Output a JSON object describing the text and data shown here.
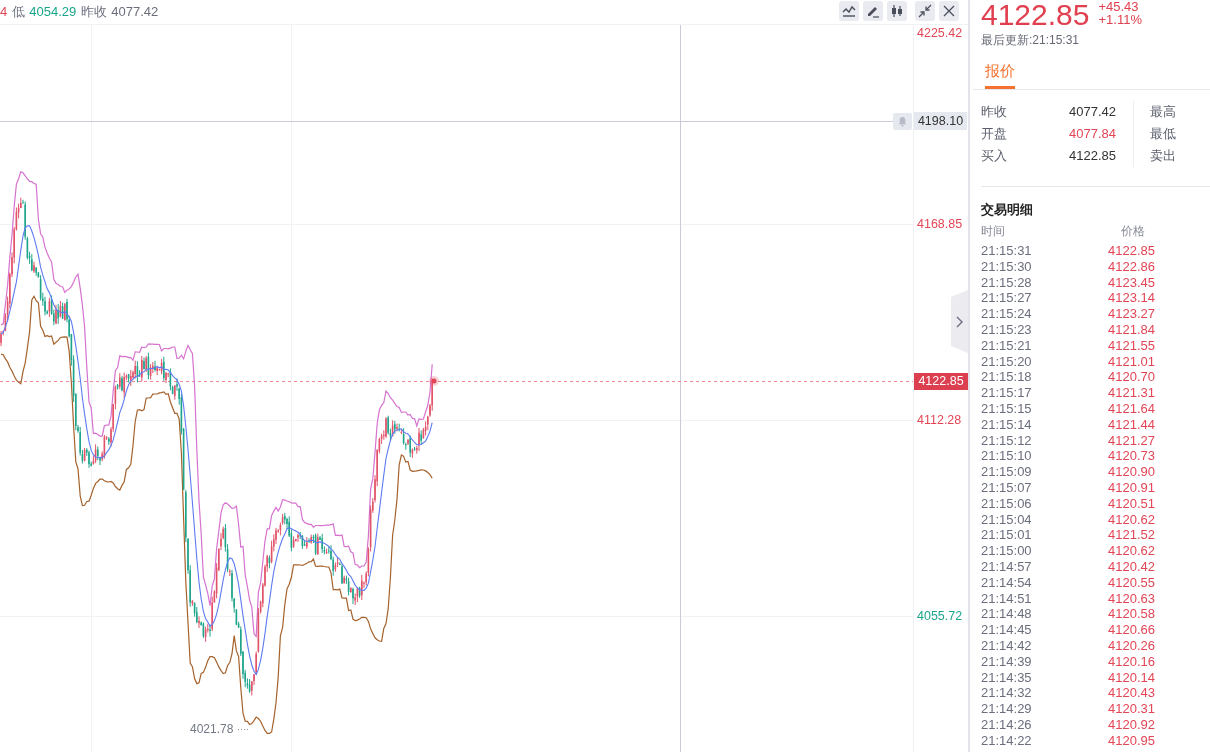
{
  "header": {
    "stats": [
      {
        "value": "4",
        "color": "#e24656"
      },
      {
        "label": "低",
        "value": "4054.29",
        "color": "#1ba68b"
      },
      {
        "label": "昨收",
        "value": "4077.42",
        "color": "#6b6f7c"
      }
    ]
  },
  "chart": {
    "axis_labels": [
      {
        "text": "4225.42",
        "color": "#e24656"
      },
      {
        "text": "4168.85",
        "color": "#e24656"
      },
      {
        "text": "4112.28",
        "color": "#e24656"
      },
      {
        "text": "4055.72",
        "color": "#1ba68b"
      }
    ],
    "crosshair_label": "4198.10",
    "last_price_label": "4122.85",
    "low_label": "4021.78"
  },
  "quote": {
    "price": "4122.85",
    "change": "+45.43",
    "change_percent": "+1.11%",
    "updated": "最后更新:21:15:31"
  },
  "tabs": [
    {
      "label": "报价",
      "selected": true
    }
  ],
  "quote_table": {
    "left": [
      {
        "label": "昨收",
        "value": "4077.42",
        "color": "#333333"
      },
      {
        "label": "开盘",
        "value": "4077.84",
        "color": "#e24656"
      },
      {
        "label": "买入",
        "value": "4122.85",
        "color": "#333333"
      }
    ],
    "right": [
      {
        "label": "最高"
      },
      {
        "label": "最低"
      },
      {
        "label": "卖出"
      }
    ]
  },
  "trades": {
    "title": "交易明细",
    "columns": [
      "时间",
      "价格"
    ],
    "rows": [
      {
        "time": "21:15:31",
        "price": "4122.85"
      },
      {
        "time": "21:15:30",
        "price": "4122.86"
      },
      {
        "time": "21:15:28",
        "price": "4123.45"
      },
      {
        "time": "21:15:27",
        "price": "4123.14"
      },
      {
        "time": "21:15:24",
        "price": "4123.27"
      },
      {
        "time": "21:15:23",
        "price": "4121.84"
      },
      {
        "time": "21:15:21",
        "price": "4121.55"
      },
      {
        "time": "21:15:20",
        "price": "4121.01"
      },
      {
        "time": "21:15:18",
        "price": "4120.70"
      },
      {
        "time": "21:15:17",
        "price": "4121.31"
      },
      {
        "time": "21:15:15",
        "price": "4121.64"
      },
      {
        "time": "21:15:14",
        "price": "4121.44"
      },
      {
        "time": "21:15:12",
        "price": "4121.27"
      },
      {
        "time": "21:15:10",
        "price": "4120.73"
      },
      {
        "time": "21:15:09",
        "price": "4120.90"
      },
      {
        "time": "21:15:07",
        "price": "4120.91"
      },
      {
        "time": "21:15:06",
        "price": "4120.51"
      },
      {
        "time": "21:15:04",
        "price": "4120.62"
      },
      {
        "time": "21:15:01",
        "price": "4121.52"
      },
      {
        "time": "21:15:00",
        "price": "4120.62"
      },
      {
        "time": "21:14:57",
        "price": "4120.42"
      },
      {
        "time": "21:14:54",
        "price": "4120.55"
      },
      {
        "time": "21:14:51",
        "price": "4120.63"
      },
      {
        "time": "21:14:48",
        "price": "4120.58"
      },
      {
        "time": "21:14:45",
        "price": "4120.66"
      },
      {
        "time": "21:14:42",
        "price": "4120.26"
      },
      {
        "time": "21:14:39",
        "price": "4120.16"
      },
      {
        "time": "21:14:35",
        "price": "4120.14"
      },
      {
        "time": "21:14:32",
        "price": "4120.43"
      },
      {
        "time": "21:14:29",
        "price": "4120.31"
      },
      {
        "time": "21:14:26",
        "price": "4120.92"
      },
      {
        "time": "21:14:22",
        "price": "4120.95"
      }
    ]
  }
}
